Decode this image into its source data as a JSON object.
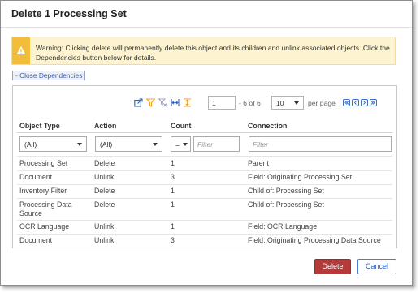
{
  "dialog": {
    "title": "Delete 1 Processing Set"
  },
  "warning": {
    "icon": "warning-triangle-icon",
    "text": "Warning: Clicking delete will permanently delete this object and its children and unlink associated objects. Click the Dependencies button below for details."
  },
  "close_dependencies_label": "- Close Dependencies",
  "toolbar": {
    "icons": [
      "export-icon",
      "filter-icon",
      "clear-filters-icon",
      "fit-columns-icon",
      "fit-rows-icon"
    ],
    "page_value": "1",
    "page_of": "- 6 of 6",
    "per_page_value": "10",
    "per_page_label": "per page"
  },
  "columns": [
    "Object Type",
    "Action",
    "Count",
    "Connection"
  ],
  "filters": {
    "object_type": "(All)",
    "action": "(All)",
    "count_operator": "=",
    "count_placeholder": "Filter",
    "connection_placeholder": "Filter"
  },
  "rows": [
    {
      "object_type": "Processing Set",
      "action": "Delete",
      "count": "1",
      "connection": "Parent"
    },
    {
      "object_type": "Document",
      "action": "Unlink",
      "count": "3",
      "connection": "Field: Originating Processing Set"
    },
    {
      "object_type": "Inventory Filter",
      "action": "Delete",
      "count": "1",
      "connection": "Child of: Processing Set"
    },
    {
      "object_type": "Processing Data Source",
      "action": "Delete",
      "count": "1",
      "connection": "Child of: Processing Set"
    },
    {
      "object_type": "OCR Language",
      "action": "Unlink",
      "count": "1",
      "connection": "Field: OCR Language"
    },
    {
      "object_type": "Document",
      "action": "Unlink",
      "count": "3",
      "connection": "Field: Originating Processing Data Source"
    }
  ],
  "buttons": {
    "delete": "Delete",
    "cancel": "Cancel"
  },
  "colors": {
    "warning_bg": "#fdf3d0",
    "warning_icon_bg": "#f3bd3c",
    "delete_button": "#b53a3a",
    "link_blue": "#2f63c4",
    "toolbar_orange": "#f2a02b"
  }
}
